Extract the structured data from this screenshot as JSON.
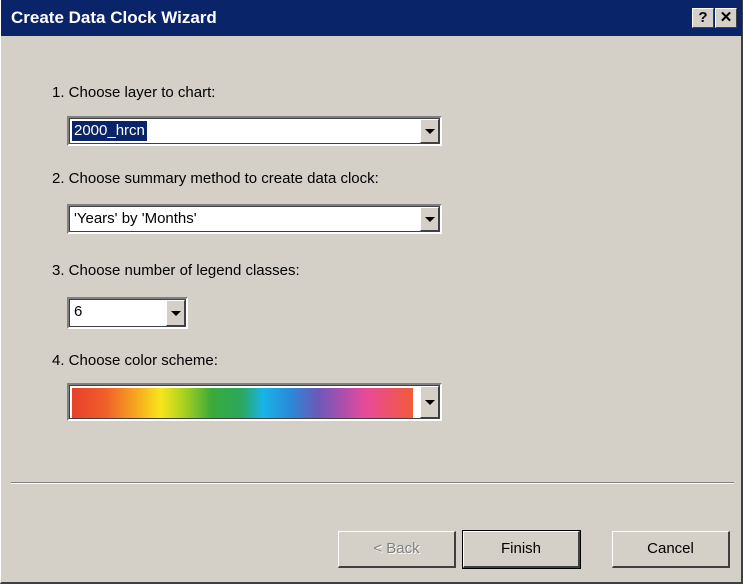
{
  "window": {
    "title": "Create Data Clock Wizard",
    "help_glyph": "?",
    "close_glyph": "✕"
  },
  "step1": {
    "label": "1. Choose layer to chart:",
    "value": "2000_hrcn"
  },
  "step2": {
    "label": "2. Choose summary method to create data clock:",
    "value": "'Years' by 'Months'"
  },
  "step3": {
    "label": "3. Choose number of legend classes:",
    "value": "6"
  },
  "step4": {
    "label": "4. Choose color scheme:",
    "value_icon": "rainbow-color-ramp"
  },
  "buttons": {
    "back": "< Back",
    "finish": "Finish",
    "cancel": "Cancel"
  },
  "colors": {
    "titlebar": "#0a246a",
    "dialog_bg": "#d4d0c8",
    "selection": "#0a246a"
  }
}
